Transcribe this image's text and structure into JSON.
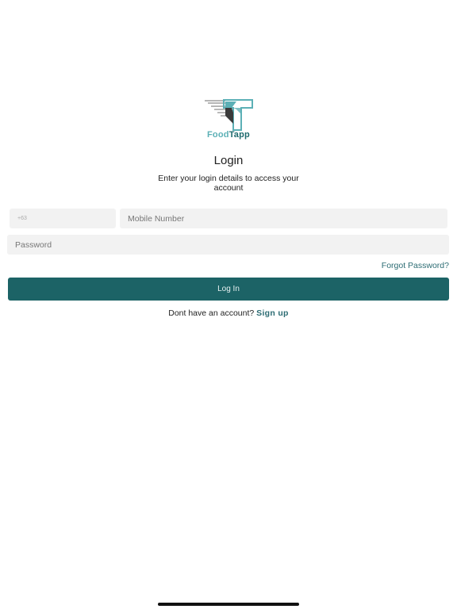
{
  "brand": {
    "name_part1": "Food",
    "name_part2": "Tapp",
    "color_light": "#5cb0b6",
    "color_dark": "#1e6b6e"
  },
  "login": {
    "title": "Login",
    "subtitle": "Enter your login details to access your account",
    "country_code_placeholder": "+63",
    "mobile_placeholder": "Mobile Number",
    "password_placeholder": "Password",
    "forgot_password": "Forgot Password?",
    "button_label": "Log In",
    "signup_prompt": "Dont have an account?",
    "signup_link": "Sign up"
  },
  "colors": {
    "primary": "#1c6366",
    "link": "#2c6c73",
    "field_bg": "#f2f2f2"
  }
}
